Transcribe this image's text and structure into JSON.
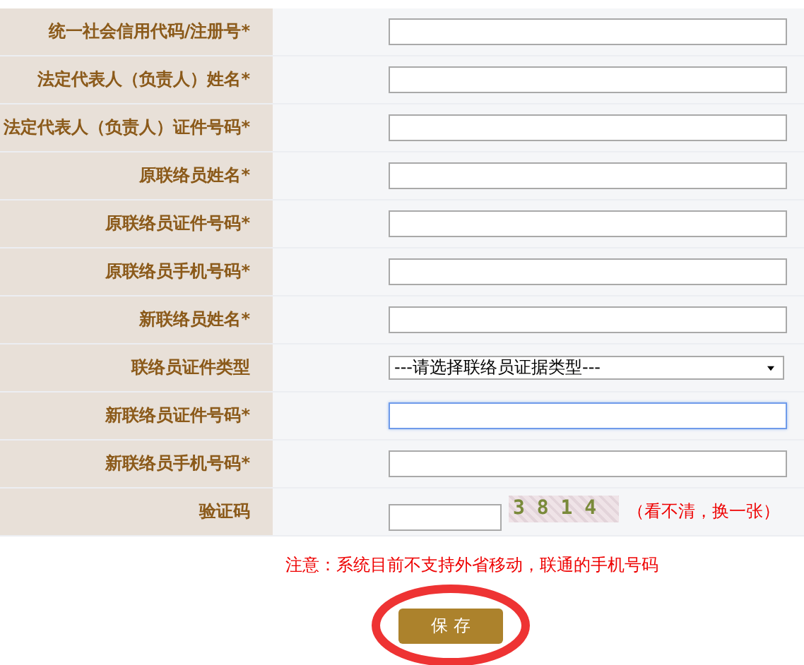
{
  "form": {
    "rows": [
      {
        "kind": "text",
        "label": "统一社会信用代码/注册号*",
        "focused": false
      },
      {
        "kind": "text",
        "label": "法定代表人（负责人）姓名*",
        "focused": false
      },
      {
        "kind": "text",
        "label": "法定代表人（负责人）证件号码*",
        "focused": false
      },
      {
        "kind": "text",
        "label": "原联络员姓名*",
        "focused": false
      },
      {
        "kind": "text",
        "label": "原联络员证件号码*",
        "focused": false
      },
      {
        "kind": "text",
        "label": "原联络员手机号码*",
        "focused": false
      },
      {
        "kind": "text",
        "label": "新联络员姓名*",
        "focused": false
      },
      {
        "kind": "select",
        "label": "联络员证件类型",
        "value": "---请选择联络员证据类型---",
        "focused": false
      },
      {
        "kind": "text",
        "label": "新联络员证件号码*",
        "focused": true
      },
      {
        "kind": "text",
        "label": "新联络员手机号码*",
        "focused": false
      },
      {
        "kind": "captcha",
        "label": "验证码",
        "code": "3 8 1 4",
        "refresh": "（看不清，换一张）",
        "focused": false
      }
    ]
  },
  "notice": "注意：系统目前不支持外省移动，联通的手机号码",
  "save_button": "保 存"
}
